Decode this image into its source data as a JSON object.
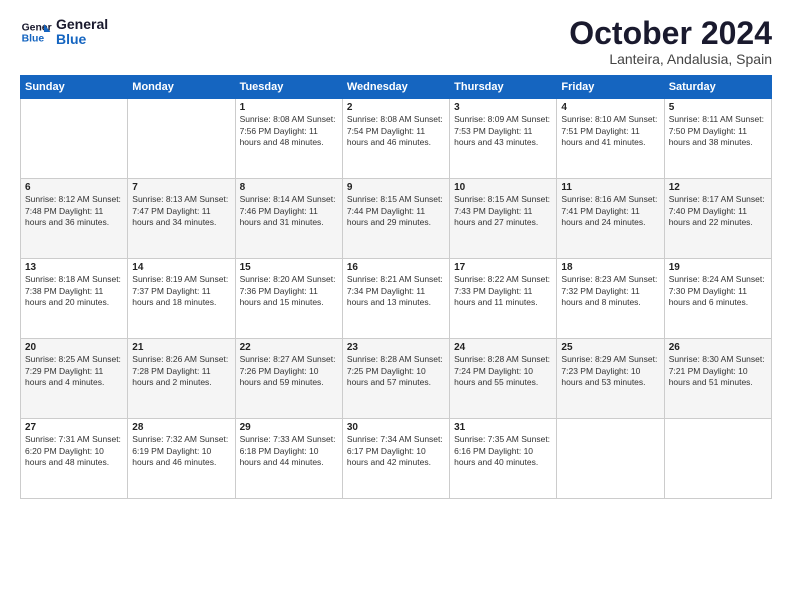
{
  "header": {
    "logo_line1": "General",
    "logo_line2": "Blue",
    "month": "October 2024",
    "location": "Lanteira, Andalusia, Spain"
  },
  "weekdays": [
    "Sunday",
    "Monday",
    "Tuesday",
    "Wednesday",
    "Thursday",
    "Friday",
    "Saturday"
  ],
  "weeks": [
    [
      {
        "day": "",
        "info": ""
      },
      {
        "day": "",
        "info": ""
      },
      {
        "day": "1",
        "info": "Sunrise: 8:08 AM\nSunset: 7:56 PM\nDaylight: 11 hours and 48 minutes."
      },
      {
        "day": "2",
        "info": "Sunrise: 8:08 AM\nSunset: 7:54 PM\nDaylight: 11 hours and 46 minutes."
      },
      {
        "day": "3",
        "info": "Sunrise: 8:09 AM\nSunset: 7:53 PM\nDaylight: 11 hours and 43 minutes."
      },
      {
        "day": "4",
        "info": "Sunrise: 8:10 AM\nSunset: 7:51 PM\nDaylight: 11 hours and 41 minutes."
      },
      {
        "day": "5",
        "info": "Sunrise: 8:11 AM\nSunset: 7:50 PM\nDaylight: 11 hours and 38 minutes."
      }
    ],
    [
      {
        "day": "6",
        "info": "Sunrise: 8:12 AM\nSunset: 7:48 PM\nDaylight: 11 hours and 36 minutes."
      },
      {
        "day": "7",
        "info": "Sunrise: 8:13 AM\nSunset: 7:47 PM\nDaylight: 11 hours and 34 minutes."
      },
      {
        "day": "8",
        "info": "Sunrise: 8:14 AM\nSunset: 7:46 PM\nDaylight: 11 hours and 31 minutes."
      },
      {
        "day": "9",
        "info": "Sunrise: 8:15 AM\nSunset: 7:44 PM\nDaylight: 11 hours and 29 minutes."
      },
      {
        "day": "10",
        "info": "Sunrise: 8:15 AM\nSunset: 7:43 PM\nDaylight: 11 hours and 27 minutes."
      },
      {
        "day": "11",
        "info": "Sunrise: 8:16 AM\nSunset: 7:41 PM\nDaylight: 11 hours and 24 minutes."
      },
      {
        "day": "12",
        "info": "Sunrise: 8:17 AM\nSunset: 7:40 PM\nDaylight: 11 hours and 22 minutes."
      }
    ],
    [
      {
        "day": "13",
        "info": "Sunrise: 8:18 AM\nSunset: 7:38 PM\nDaylight: 11 hours and 20 minutes."
      },
      {
        "day": "14",
        "info": "Sunrise: 8:19 AM\nSunset: 7:37 PM\nDaylight: 11 hours and 18 minutes."
      },
      {
        "day": "15",
        "info": "Sunrise: 8:20 AM\nSunset: 7:36 PM\nDaylight: 11 hours and 15 minutes."
      },
      {
        "day": "16",
        "info": "Sunrise: 8:21 AM\nSunset: 7:34 PM\nDaylight: 11 hours and 13 minutes."
      },
      {
        "day": "17",
        "info": "Sunrise: 8:22 AM\nSunset: 7:33 PM\nDaylight: 11 hours and 11 minutes."
      },
      {
        "day": "18",
        "info": "Sunrise: 8:23 AM\nSunset: 7:32 PM\nDaylight: 11 hours and 8 minutes."
      },
      {
        "day": "19",
        "info": "Sunrise: 8:24 AM\nSunset: 7:30 PM\nDaylight: 11 hours and 6 minutes."
      }
    ],
    [
      {
        "day": "20",
        "info": "Sunrise: 8:25 AM\nSunset: 7:29 PM\nDaylight: 11 hours and 4 minutes."
      },
      {
        "day": "21",
        "info": "Sunrise: 8:26 AM\nSunset: 7:28 PM\nDaylight: 11 hours and 2 minutes."
      },
      {
        "day": "22",
        "info": "Sunrise: 8:27 AM\nSunset: 7:26 PM\nDaylight: 10 hours and 59 minutes."
      },
      {
        "day": "23",
        "info": "Sunrise: 8:28 AM\nSunset: 7:25 PM\nDaylight: 10 hours and 57 minutes."
      },
      {
        "day": "24",
        "info": "Sunrise: 8:28 AM\nSunset: 7:24 PM\nDaylight: 10 hours and 55 minutes."
      },
      {
        "day": "25",
        "info": "Sunrise: 8:29 AM\nSunset: 7:23 PM\nDaylight: 10 hours and 53 minutes."
      },
      {
        "day": "26",
        "info": "Sunrise: 8:30 AM\nSunset: 7:21 PM\nDaylight: 10 hours and 51 minutes."
      }
    ],
    [
      {
        "day": "27",
        "info": "Sunrise: 7:31 AM\nSunset: 6:20 PM\nDaylight: 10 hours and 48 minutes."
      },
      {
        "day": "28",
        "info": "Sunrise: 7:32 AM\nSunset: 6:19 PM\nDaylight: 10 hours and 46 minutes."
      },
      {
        "day": "29",
        "info": "Sunrise: 7:33 AM\nSunset: 6:18 PM\nDaylight: 10 hours and 44 minutes."
      },
      {
        "day": "30",
        "info": "Sunrise: 7:34 AM\nSunset: 6:17 PM\nDaylight: 10 hours and 42 minutes."
      },
      {
        "day": "31",
        "info": "Sunrise: 7:35 AM\nSunset: 6:16 PM\nDaylight: 10 hours and 40 minutes."
      },
      {
        "day": "",
        "info": ""
      },
      {
        "day": "",
        "info": ""
      }
    ]
  ]
}
